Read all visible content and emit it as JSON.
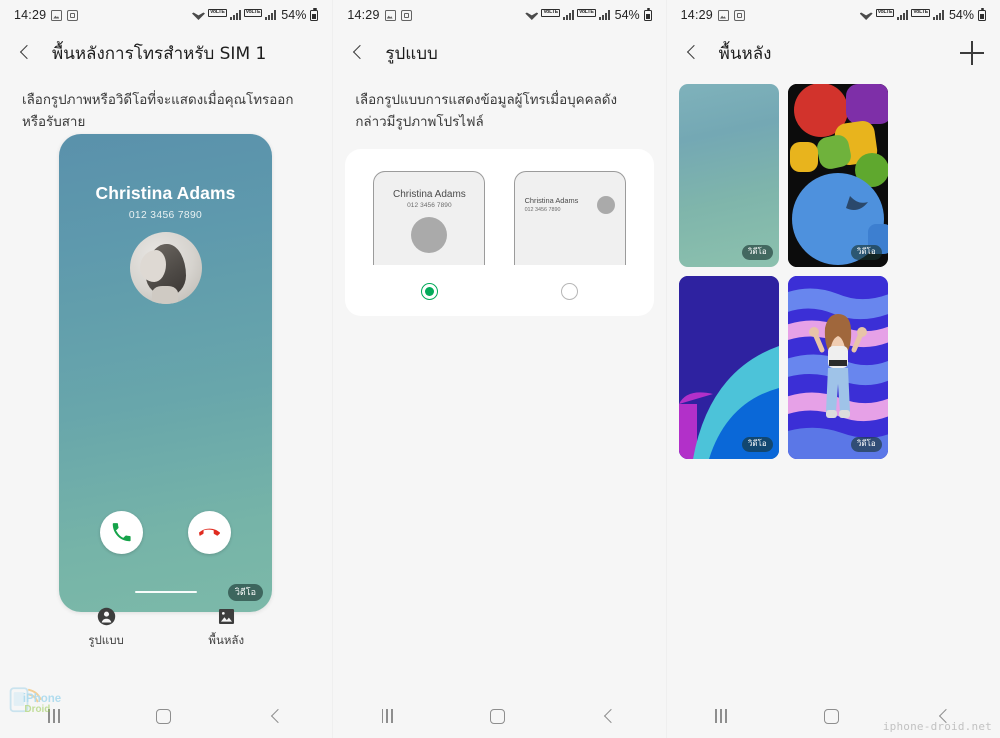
{
  "statusbar": {
    "time": "14:29",
    "battery_percent": "54%",
    "network_label_1": "VoLTE",
    "network_label_2": "VoLTE",
    "icons": [
      "photo-icon",
      "screen-capture-icon",
      "wifi-icon",
      "signal-bars-icon",
      "battery-icon"
    ]
  },
  "panel1": {
    "title": "พื้นหลังการโทรสำหรับ SIM 1",
    "description": "เลือกรูปภาพหรือวิดีโอที่จะแสดงเมื่อคุณโทรออกหรือรับสาย",
    "preview": {
      "caller_name": "Christina Adams",
      "caller_number": "012 3456 7890",
      "video_badge": "วิดีโอ",
      "accept_label": "accept-call",
      "decline_label": "decline-call"
    },
    "tabs": [
      {
        "label": "รูปแบบ",
        "icon": "person-icon"
      },
      {
        "label": "พื้นหลัง",
        "icon": "image-icon"
      }
    ]
  },
  "panel2": {
    "title": "รูปแบบ",
    "description": "เลือกรูปแบบการแสดงข้อมูลผู้โทรเมื่อบุคคลดังกล่าวมีรูปภาพโปรไฟล์",
    "options": [
      {
        "name": "Christina Adams",
        "number": "012 3456 7890",
        "selected": true,
        "layout": "centered"
      },
      {
        "name": "Christina Adams",
        "number": "012 3456 7890",
        "selected": false,
        "layout": "left-aligned"
      }
    ]
  },
  "panel3": {
    "title": "พื้นหลัง",
    "add_button": "add-icon",
    "wallpapers": [
      {
        "badge": "วิดีโอ",
        "style": "wp-teal",
        "name": "teal-gradient-wallpaper"
      },
      {
        "badge": "วิดีโอ",
        "style": "wp-balls",
        "name": "colorful-shapes-wallpaper"
      },
      {
        "badge": "วิดีโอ",
        "style": "wp-indigo",
        "name": "indigo-curves-wallpaper"
      },
      {
        "badge": "วิดีโอ",
        "style": "wp-emoji",
        "name": "ar-emoji-wallpaper"
      }
    ]
  },
  "navbar": {
    "recents": "recents-icon",
    "home": "home-icon",
    "back": "back-icon"
  },
  "watermark": {
    "text": "iphone-droid.net",
    "logo_line1": "iPhone",
    "logo_line2": "Droid"
  },
  "colors": {
    "accent_green": "#03aa5a",
    "accept": "#16a34a",
    "decline": "#e02b20",
    "bg": "#f6f6f6"
  }
}
